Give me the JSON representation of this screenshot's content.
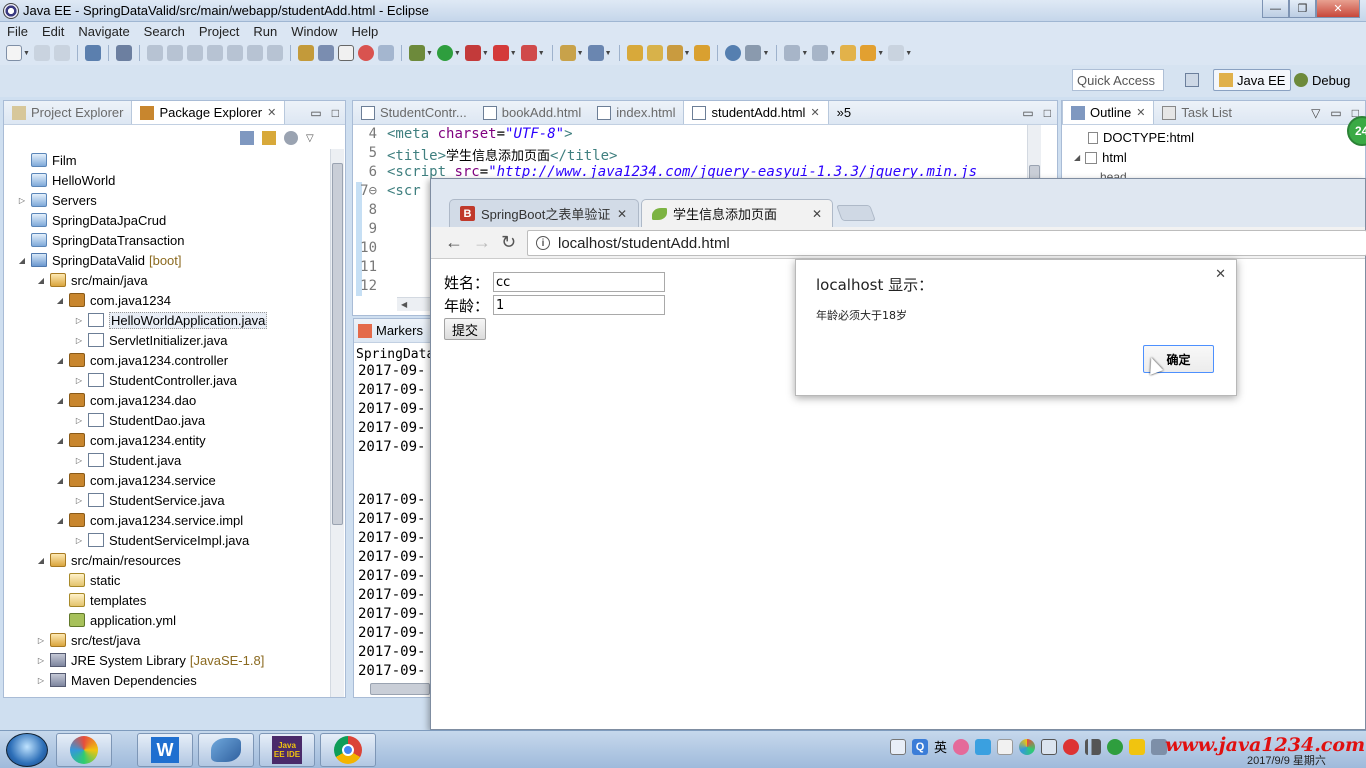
{
  "window": {
    "title": "Java EE - SpringDataValid/src/main/webapp/studentAdd.html - Eclipse",
    "buttons": [
      "—",
      "❐",
      "✕"
    ]
  },
  "menu": [
    "File",
    "Edit",
    "Navigate",
    "Search",
    "Project",
    "Run",
    "Window",
    "Help"
  ],
  "perspective": {
    "quick_access": "Quick Access",
    "java_ee": "Java EE",
    "debug": "Debug"
  },
  "left_panel": {
    "tabs": [
      {
        "label": "Project Explorer",
        "active": false
      },
      {
        "label": "Package Explorer",
        "active": true
      }
    ],
    "tree": [
      {
        "label": "Film",
        "depth": 0,
        "twisty": "",
        "icon": "folder"
      },
      {
        "label": "HelloWorld",
        "depth": 0,
        "twisty": "",
        "icon": "folder"
      },
      {
        "label": "Servers",
        "depth": 0,
        "twisty": "▷",
        "icon": "folder"
      },
      {
        "label": "SpringDataJpaCrud",
        "depth": 0,
        "twisty": "",
        "icon": "folder"
      },
      {
        "label": "SpringDataTransaction",
        "depth": 0,
        "twisty": "",
        "icon": "folder"
      },
      {
        "label": "SpringDataValid",
        "decoration": "[boot]",
        "depth": 0,
        "twisty": "◢",
        "icon": "proj"
      },
      {
        "label": "src/main/java",
        "depth": 1,
        "twisty": "◢",
        "icon": "srcfolder"
      },
      {
        "label": "com.java1234",
        "depth": 2,
        "twisty": "◢",
        "icon": "pkg"
      },
      {
        "label": "HelloWorldApplication.java",
        "depth": 3,
        "twisty": "▷",
        "icon": "java",
        "selected": true
      },
      {
        "label": "ServletInitializer.java",
        "depth": 3,
        "twisty": "▷",
        "icon": "java"
      },
      {
        "label": "com.java1234.controller",
        "depth": 2,
        "twisty": "◢",
        "icon": "pkg"
      },
      {
        "label": "StudentController.java",
        "depth": 3,
        "twisty": "▷",
        "icon": "java"
      },
      {
        "label": "com.java1234.dao",
        "depth": 2,
        "twisty": "◢",
        "icon": "pkg"
      },
      {
        "label": "StudentDao.java",
        "depth": 3,
        "twisty": "▷",
        "icon": "java"
      },
      {
        "label": "com.java1234.entity",
        "depth": 2,
        "twisty": "◢",
        "icon": "pkg"
      },
      {
        "label": "Student.java",
        "depth": 3,
        "twisty": "▷",
        "icon": "java"
      },
      {
        "label": "com.java1234.service",
        "depth": 2,
        "twisty": "◢",
        "icon": "pkg"
      },
      {
        "label": "StudentService.java",
        "depth": 3,
        "twisty": "▷",
        "icon": "java"
      },
      {
        "label": "com.java1234.service.impl",
        "depth": 2,
        "twisty": "◢",
        "icon": "pkg"
      },
      {
        "label": "StudentServiceImpl.java",
        "depth": 3,
        "twisty": "▷",
        "icon": "java"
      },
      {
        "label": "src/main/resources",
        "depth": 1,
        "twisty": "◢",
        "icon": "srcfolder"
      },
      {
        "label": "static",
        "depth": 2,
        "twisty": "",
        "icon": "res"
      },
      {
        "label": "templates",
        "depth": 2,
        "twisty": "",
        "icon": "res"
      },
      {
        "label": "application.yml",
        "depth": 2,
        "twisty": "",
        "icon": "yml"
      },
      {
        "label": "src/test/java",
        "depth": 1,
        "twisty": "▷",
        "icon": "srcfolder"
      },
      {
        "label": "JRE System Library",
        "decoration": "[JavaSE-1.8]",
        "depth": 1,
        "twisty": "▷",
        "icon": "lib"
      },
      {
        "label": "Maven Dependencies",
        "depth": 1,
        "twisty": "▷",
        "icon": "lib"
      }
    ]
  },
  "editor": {
    "tabs": [
      {
        "label": "StudentContr...",
        "active": false
      },
      {
        "label": "bookAdd.html",
        "active": false
      },
      {
        "label": "index.html",
        "active": false
      },
      {
        "label": "studentAdd.html",
        "active": true
      }
    ],
    "overflow": "»5",
    "lines": [
      {
        "n": "4",
        "html": "<span class='tag'>&lt;meta</span> <span class='attr'>charset</span>=<span class='str'>\"UTF-8\"</span><span class='tag'>&gt;</span>"
      },
      {
        "n": "5",
        "html": "<span class='tag'>&lt;title&gt;</span><span class='txt'>学生信息添加页面</span><span class='tag'>&lt;/title&gt;</span>"
      },
      {
        "n": "6",
        "html": "<span class='tag'>&lt;script</span> <span class='attr'>src</span>=<span class='str'>\"http://www.java1234.com/jquery-easyui-1.3.3/jquery.min.js</span>"
      },
      {
        "n": "7⊖",
        "html": "<span class='tag'>&lt;scr</span>"
      },
      {
        "n": "8",
        "html": ""
      },
      {
        "n": "9",
        "html": ""
      },
      {
        "n": "10",
        "html": ""
      },
      {
        "n": "11",
        "html": ""
      },
      {
        "n": "12",
        "html": ""
      }
    ]
  },
  "console": {
    "tab": "Markers",
    "header": "SpringDataV",
    "lines_top": [
      "2017-09-",
      "2017-09-",
      "2017-09-",
      "2017-09-",
      "2017-09-"
    ],
    "lines_bottom": [
      "2017-09-",
      "2017-09-",
      "2017-09-",
      "2017-09-",
      "2017-09-",
      "2017-09-",
      "2017-09-",
      "2017-09-",
      "2017-09-",
      "2017-09-"
    ]
  },
  "outline": {
    "tabs": [
      {
        "label": "Outline",
        "active": true
      },
      {
        "label": "Task List",
        "active": false
      }
    ],
    "items": [
      "DOCTYPE:html",
      "html",
      "head"
    ]
  },
  "browser": {
    "tabs": [
      {
        "label": "SpringBoot之表单验证@",
        "active": false
      },
      {
        "label": "学生信息添加页面",
        "active": true
      }
    ],
    "url": "localhost/studentAdd.html",
    "form": {
      "name_label": "姓名：",
      "name_value": "cc",
      "age_label": "年龄：",
      "age_value": "1",
      "submit": "提交"
    },
    "alert": {
      "title": "localhost 显示：",
      "message": "年龄必须大于18岁",
      "ok": "确定",
      "close": "✕"
    }
  },
  "taskbar": {
    "apps": [
      "W",
      "Java EE IDE"
    ],
    "ime": "英",
    "watermark": "www.java1234.com",
    "date": "2017/9/9 星期六",
    "badge": "24"
  },
  "colors": {
    "eclipse_frame": "#cfdff0",
    "accent_blue": "#4d90fe",
    "watermark_red": "#e01010"
  }
}
